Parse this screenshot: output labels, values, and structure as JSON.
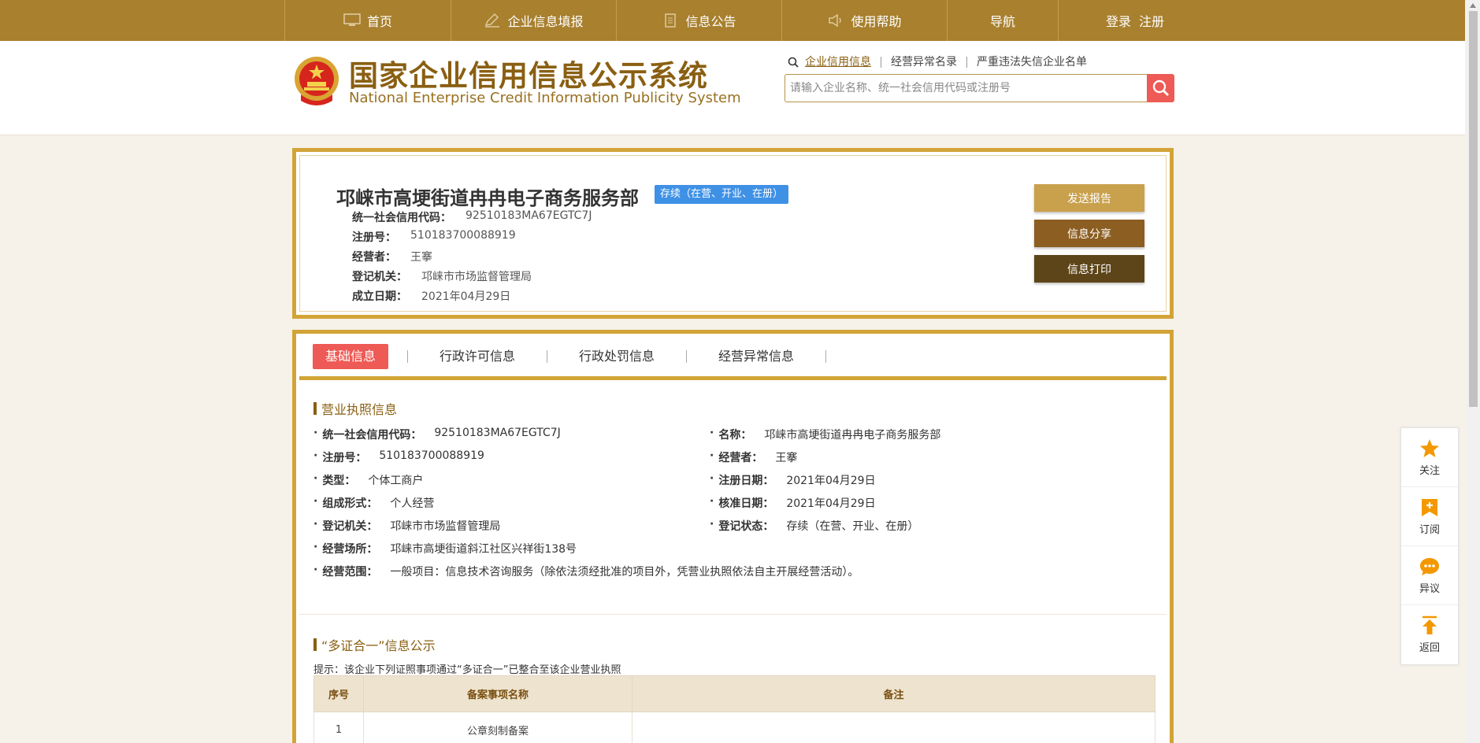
{
  "topnav": {
    "items": [
      {
        "label": "首页",
        "icon": "monitor-icon"
      },
      {
        "label": "企业信息填报",
        "icon": "pen-icon"
      },
      {
        "label": "信息公告",
        "icon": "document-icon"
      },
      {
        "label": "使用帮助",
        "icon": "speaker-icon"
      },
      {
        "label": "导航",
        "icon": ""
      },
      {
        "label": "登录",
        "icon": ""
      }
    ],
    "register_label": "注册"
  },
  "header": {
    "logo_cn": "国家企业信用信息公示系统",
    "logo_en": "National Enterprise Credit Information Publicity System",
    "search_tabs": [
      "企业信用信息",
      "经营异常名录",
      "严重违法失信企业名单"
    ],
    "search_placeholder": "请输入企业名称、统一社会信用代码或注册号"
  },
  "company": {
    "name": "邛崃市高埂街道冉冉电子商务服务部",
    "status": "存续（在营、开业、在册）",
    "fields": [
      {
        "label": "统一社会信用代码：",
        "value": "92510183MA67EGTC7J"
      },
      {
        "label": "注册号：",
        "value": "510183700088919"
      },
      {
        "label": "经营者：",
        "value": "王搴"
      },
      {
        "label": "登记机关：",
        "value": "邛崃市市场监督管理局"
      },
      {
        "label": "成立日期：",
        "value": "2021年04月29日"
      }
    ],
    "actions": {
      "send_report": "发送报告",
      "share": "信息分享",
      "print": "信息打印"
    }
  },
  "tabs": [
    "基础信息",
    "行政许可信息",
    "行政处罚信息",
    "经营异常信息"
  ],
  "license": {
    "title": "营业执照信息",
    "left": [
      {
        "label": "统一社会信用代码：",
        "value": "92510183MA67EGTC7J"
      },
      {
        "label": "注册号：",
        "value": "510183700088919"
      },
      {
        "label": "类型：",
        "value": "个体工商户"
      },
      {
        "label": "组成形式：",
        "value": "个人经营"
      },
      {
        "label": "登记机关：",
        "value": "邛崃市市场监督管理局"
      },
      {
        "label": "经营场所：",
        "value": "邛崃市高埂街道斜江社区兴祥街138号"
      },
      {
        "label": "经营范围：",
        "value": "一般项目：信息技术咨询服务（除依法须经批准的项目外，凭营业执照依法自主开展经营活动）。"
      }
    ],
    "right": [
      {
        "label": "名称：",
        "value": "邛崃市高埂街道冉冉电子商务服务部"
      },
      {
        "label": "经营者：",
        "value": "王搴"
      },
      {
        "label": "注册日期：",
        "value": "2021年04月29日"
      },
      {
        "label": "核准日期：",
        "value": "2021年04月29日"
      },
      {
        "label": "登记状态：",
        "value": "存续（在营、开业、在册）"
      }
    ]
  },
  "multi_cert": {
    "title": "“多证合一”信息公示",
    "hint": "提示：该企业下列证照事项通过“多证合一”已整合至该企业营业执照",
    "columns": [
      "序号",
      "备案事项名称",
      "备注"
    ],
    "rows": [
      [
        "1",
        "公章刻制备案",
        ""
      ]
    ]
  },
  "sidebar": {
    "items": [
      {
        "label": "关注",
        "icon": "star-icon"
      },
      {
        "label": "订阅",
        "icon": "subscribe-icon"
      },
      {
        "label": "异议",
        "icon": "chat-icon"
      },
      {
        "label": "返回",
        "icon": "back-to-top-icon"
      }
    ]
  },
  "colors": {
    "nav_gold": "#a8802e",
    "border_gold": "#d2a437",
    "status_blue": "#3f91e6",
    "accent_red": "#ee5a55",
    "btn_gold_light": "#c9a04c",
    "btn_brown": "#8c5e22",
    "btn_dark": "#5e4519"
  }
}
